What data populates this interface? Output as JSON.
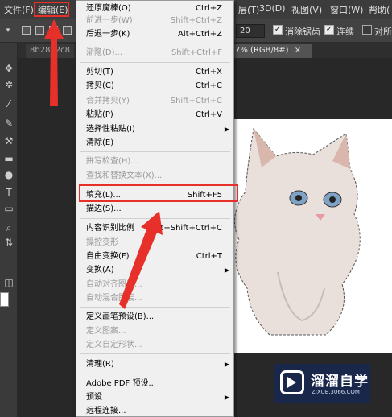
{
  "menubar": {
    "file": "文件(F)",
    "edit": "编辑(E)",
    "layer_partial": "层(T)",
    "threed": "3D(D)",
    "view": "视图(V)",
    "window": "窗口(W)",
    "help": "帮助("
  },
  "options": {
    "tolerance_value": "20",
    "antialias_label": "消除锯齿",
    "contiguous_label": "连续",
    "sample_all_label": "对所"
  },
  "tabs": {
    "left_tab": "8b28b2c8",
    "active_tab": "7% (RGB/8#)",
    "close": "×"
  },
  "edit_menu": {
    "items": [
      {
        "label": "还原魔棒(O)",
        "shortcut": "Ctrl+Z",
        "disabled": false
      },
      {
        "label": "前进一步(W)",
        "shortcut": "Shift+Ctrl+Z",
        "disabled": true
      },
      {
        "label": "后退一步(K)",
        "shortcut": "Alt+Ctrl+Z",
        "disabled": false
      },
      {
        "label": "渐隐(D)...",
        "shortcut": "Shift+Ctrl+F",
        "disabled": true
      },
      {
        "label": "剪切(T)",
        "shortcut": "Ctrl+X",
        "disabled": false
      },
      {
        "label": "拷贝(C)",
        "shortcut": "Ctrl+C",
        "disabled": false
      },
      {
        "label": "合并拷贝(Y)",
        "shortcut": "Shift+Ctrl+C",
        "disabled": true
      },
      {
        "label": "粘贴(P)",
        "shortcut": "Ctrl+V",
        "disabled": false
      },
      {
        "label": "选择性粘贴(I)",
        "shortcut": "",
        "disabled": false,
        "submenu": true
      },
      {
        "label": "清除(E)",
        "shortcut": "",
        "disabled": false
      },
      {
        "label": "拼写检查(H)...",
        "shortcut": "",
        "disabled": true
      },
      {
        "label": "查找和替换文本(X)...",
        "shortcut": "",
        "disabled": true
      },
      {
        "label": "填充(L)...",
        "shortcut": "Shift+F5",
        "disabled": false
      },
      {
        "label": "描边(S)...",
        "shortcut": "",
        "disabled": false
      },
      {
        "label": "内容识别比例",
        "shortcut": "Alt+Shift+Ctrl+C",
        "disabled": false
      },
      {
        "label": "操控变形",
        "shortcut": "",
        "disabled": true
      },
      {
        "label": "自由变换(F)",
        "shortcut": "Ctrl+T",
        "disabled": false
      },
      {
        "label": "变换(A)",
        "shortcut": "",
        "disabled": false,
        "submenu": true
      },
      {
        "label": "自动对齐图层...",
        "shortcut": "",
        "disabled": true
      },
      {
        "label": "自动混合图层...",
        "shortcut": "",
        "disabled": true
      },
      {
        "label": "定义画笔预设(B)...",
        "shortcut": "",
        "disabled": false
      },
      {
        "label": "定义图案...",
        "shortcut": "",
        "disabled": true
      },
      {
        "label": "定义自定形状...",
        "shortcut": "",
        "disabled": true
      },
      {
        "label": "清理(R)",
        "shortcut": "",
        "disabled": false,
        "submenu": true
      },
      {
        "label": "Adobe PDF 预设...",
        "shortcut": "",
        "disabled": false
      },
      {
        "label": "预设",
        "shortcut": "",
        "disabled": false,
        "submenu": true
      },
      {
        "label": "远程连接...",
        "shortcut": "",
        "disabled": false
      }
    ]
  },
  "watermark": {
    "name": "溜溜自学",
    "url": "ZIXUE.3066.COM"
  },
  "colors": {
    "annotation_red": "#e8302a",
    "menu_bg": "#f0f0f0"
  }
}
